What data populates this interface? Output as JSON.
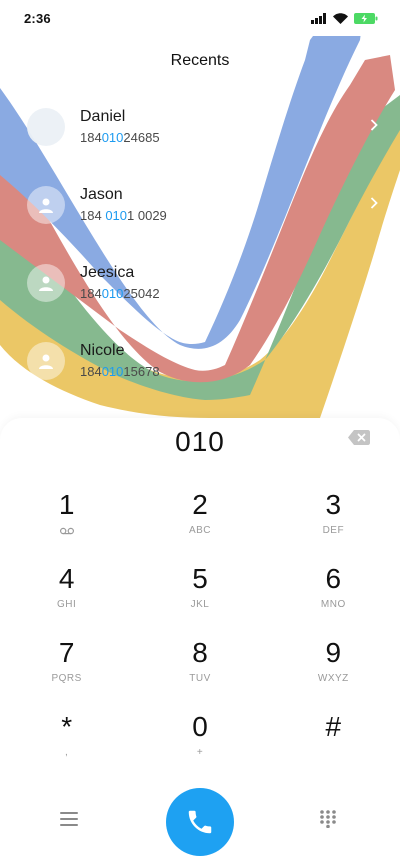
{
  "status": {
    "time": "2:36",
    "battery_color": "#4cd964"
  },
  "header": {
    "title": "Recents"
  },
  "recents": [
    {
      "name": "Daniel",
      "number_parts": [
        "184",
        "010",
        "24685"
      ],
      "has_chevron": true,
      "avatar": "plain"
    },
    {
      "name": "Jason",
      "number_parts": [
        "184 ",
        "010",
        "1 0029"
      ],
      "has_chevron": true,
      "avatar": "person-icon"
    },
    {
      "name": "Jeesica",
      "number_parts": [
        "184",
        "010",
        "25042"
      ],
      "has_chevron": false,
      "avatar": "person-icon"
    },
    {
      "name": "Nicole",
      "number_parts": [
        "184",
        "010",
        "15678"
      ],
      "has_chevron": false,
      "avatar": "person-icon"
    }
  ],
  "dialer": {
    "number": "010",
    "keys": [
      [
        {
          "digit": "1",
          "letters": ""
        },
        {
          "digit": "2",
          "letters": "ABC"
        },
        {
          "digit": "3",
          "letters": "DEF"
        }
      ],
      [
        {
          "digit": "4",
          "letters": "GHI"
        },
        {
          "digit": "5",
          "letters": "JKL"
        },
        {
          "digit": "6",
          "letters": "MNO"
        }
      ],
      [
        {
          "digit": "7",
          "letters": "PQRS"
        },
        {
          "digit": "8",
          "letters": "TUV"
        },
        {
          "digit": "9",
          "letters": "WXYZ"
        }
      ],
      [
        {
          "digit": "*",
          "letters": ","
        },
        {
          "digit": "0",
          "letters": "+"
        },
        {
          "digit": "#",
          "letters": ""
        }
      ]
    ]
  },
  "colors": {
    "accent": "#1ea1f2",
    "highlight": "#1d9bf0",
    "wave_blue": "#8aaae2",
    "wave_red": "#d98981",
    "wave_green": "#86b98f",
    "wave_yellow": "#ebc766"
  }
}
